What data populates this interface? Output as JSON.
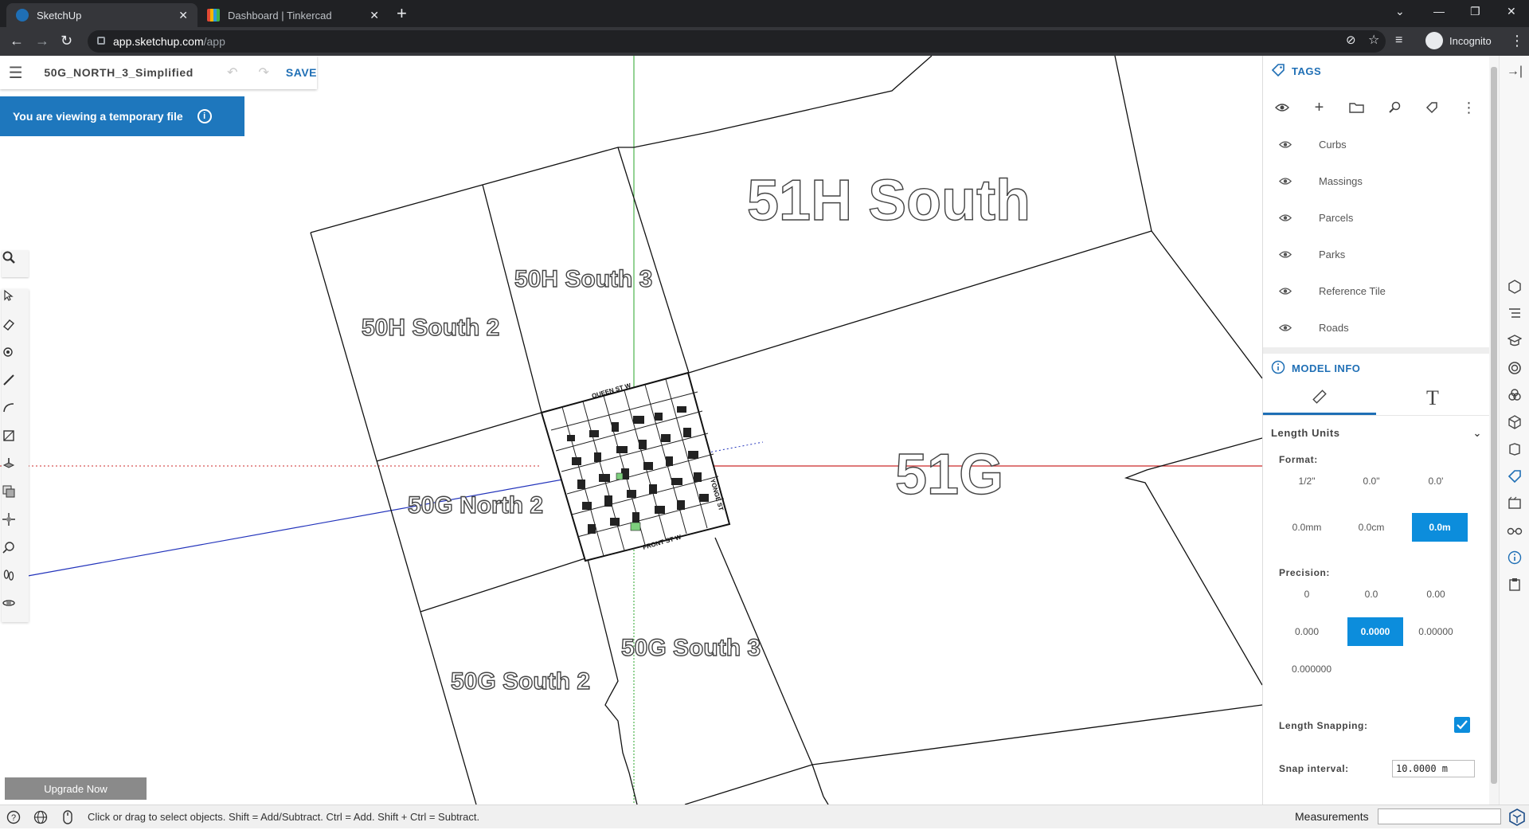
{
  "browser": {
    "tabs": [
      {
        "title": "SketchUp",
        "active": true
      },
      {
        "title": "Dashboard | Tinkercad",
        "active": false
      }
    ],
    "url_host": "app.sketchup.com",
    "url_path": "/app",
    "profile_label": "Incognito"
  },
  "file": {
    "name": "50G_NORTH_3_Simplified",
    "save_label": "SAVE",
    "temp_banner": "You are viewing a temporary file"
  },
  "viewport": {
    "labels": {
      "l51h": "51H South",
      "l50h3": "50H South 3",
      "l50h2": "50H South 2",
      "l51g": "51G",
      "l50gn2": "50G North 2",
      "l50gs3": "50G South 3",
      "l50gs2": "50G South 2",
      "queen": "QUEEN ST W",
      "yonge": "YONGE ST",
      "front": "FRONT ST W"
    },
    "colors": {
      "red_axis": "#cc2a2a",
      "green_axis": "#2aa52a",
      "blue_axis": "#2233bb"
    }
  },
  "upgrade_label": "Upgrade Now",
  "tags_panel": {
    "title": "TAGS",
    "tags": [
      "Curbs",
      "Massings",
      "Parcels",
      "Parks",
      "Reference Tile",
      "Roads"
    ]
  },
  "model_info": {
    "title": "MODEL INFO",
    "section": "Length Units",
    "format_label": "Format:",
    "format_options": [
      "1/2\"",
      "0.0\"",
      "0.0'",
      "0.0mm",
      "0.0cm",
      "0.0m"
    ],
    "format_selected": "0.0m",
    "precision_label": "Precision:",
    "precision_options": [
      "0",
      "0.0",
      "0.00",
      "0.000",
      "0.0000",
      "0.00000",
      "0.000000"
    ],
    "precision_selected": "0.0000",
    "snapping_label": "Length Snapping:",
    "snapping_enabled": true,
    "snap_interval_label": "Snap interval:",
    "snap_interval_value": "10.0000 m"
  },
  "status": {
    "hint": "Click or drag to select objects. Shift = Add/Subtract. Ctrl = Add. Shift + Ctrl = Subtract.",
    "measurements_label": "Measurements"
  },
  "accent": "#1f6fb5",
  "selected_color": "#0c8ddc"
}
